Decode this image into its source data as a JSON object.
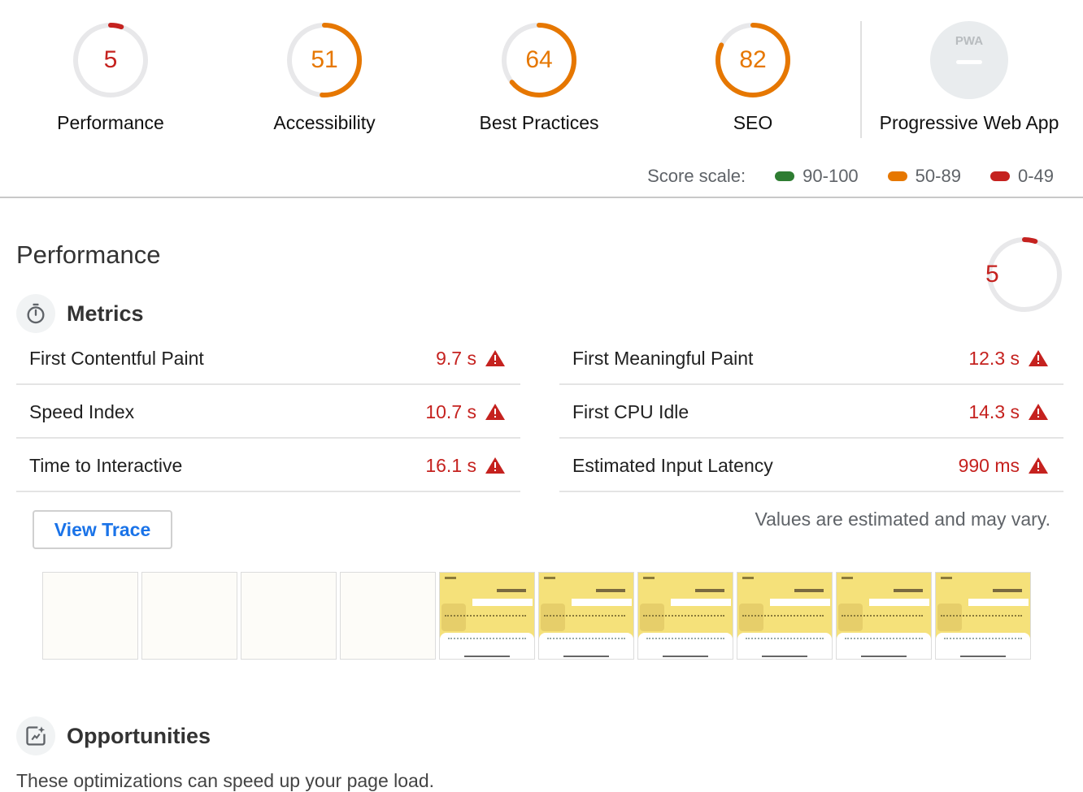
{
  "summary": {
    "gauges": [
      {
        "score": "5",
        "label": "Performance",
        "fraction": 0.05,
        "color": "#c5221f"
      },
      {
        "score": "51",
        "label": "Accessibility",
        "fraction": 0.51,
        "color": "#e67700"
      },
      {
        "score": "64",
        "label": "Best Practices",
        "fraction": 0.64,
        "color": "#e67700"
      },
      {
        "score": "82",
        "label": "SEO",
        "fraction": 0.82,
        "color": "#e67700"
      }
    ],
    "pwa": {
      "badge_text": "PWA",
      "label": "Progressive Web App"
    }
  },
  "score_scale": {
    "label": "Score scale:",
    "ranges": [
      {
        "text": "90-100",
        "color": "#2e7d32"
      },
      {
        "text": "50-89",
        "color": "#e67700"
      },
      {
        "text": "0-49",
        "color": "#c5221f"
      }
    ]
  },
  "performance": {
    "title": "Performance",
    "score": "5",
    "score_fraction": 0.05,
    "metrics_heading": "Metrics",
    "metrics_icon": "stopwatch-icon",
    "metrics": [
      {
        "name": "First Contentful Paint",
        "value": "9.7 s"
      },
      {
        "name": "First Meaningful Paint",
        "value": "12.3 s"
      },
      {
        "name": "Speed Index",
        "value": "10.7 s"
      },
      {
        "name": "First CPU Idle",
        "value": "14.3 s"
      },
      {
        "name": "Time to Interactive",
        "value": "16.1 s"
      },
      {
        "name": "Estimated Input Latency",
        "value": "990 ms"
      }
    ],
    "view_trace_label": "View Trace",
    "estimate_note": "Values are estimated and may vary.",
    "filmstrip_frames": [
      "blank",
      "blank",
      "blank",
      "blank",
      "loaded",
      "loaded",
      "loaded",
      "loaded",
      "loaded",
      "loaded"
    ]
  },
  "opportunities": {
    "heading": "Opportunities",
    "icon": "opportunity-icon",
    "intro_partial": "These optimizations can speed up your page load."
  }
}
